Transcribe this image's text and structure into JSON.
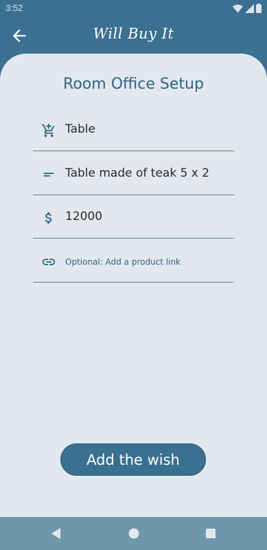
{
  "status_bar": {
    "time": "3:52"
  },
  "app_bar": {
    "title": "Will Buy It",
    "back_icon": "arrow-back-icon"
  },
  "page": {
    "title": "Room Office Setup"
  },
  "fields": [
    {
      "icon": "cart-add-icon",
      "value": "Table"
    },
    {
      "icon": "description-lines-icon",
      "value": "Table made of teak 5 x 2"
    },
    {
      "icon": "dollar-icon",
      "value": "12000"
    },
    {
      "icon": "link-icon",
      "placeholder": "Optional: Add a product link",
      "value": ""
    }
  ],
  "actions": {
    "add_label": "Add the wish"
  },
  "colors": {
    "primary": "#3b7090",
    "background": "#e3e8ef",
    "title_text": "#2f6482",
    "nav_bar": "#6e97ac"
  }
}
